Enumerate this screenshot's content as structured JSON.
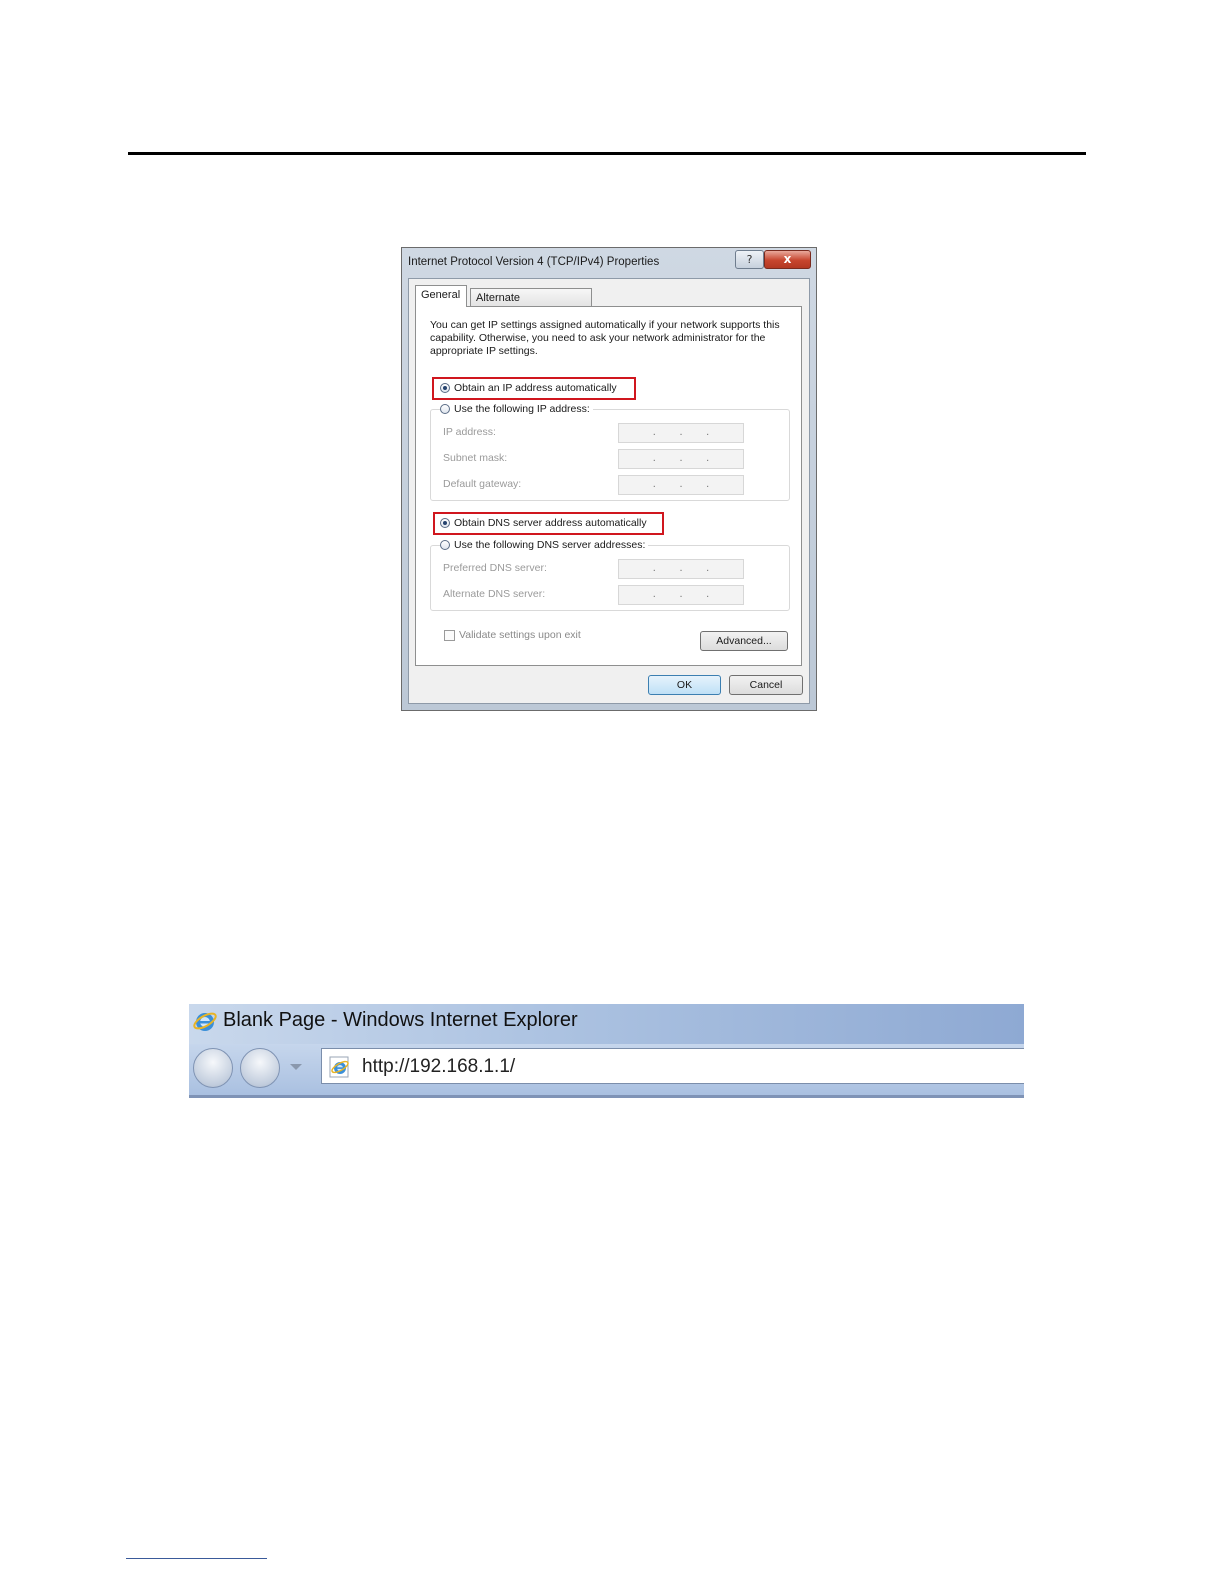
{
  "dialog": {
    "title": "Internet Protocol Version 4 (TCP/IPv4) Properties",
    "help_label": "?",
    "close_label": "x",
    "tabs": [
      {
        "label": "General"
      },
      {
        "label": "Alternate Configuration"
      }
    ],
    "description": "You can get IP settings assigned automatically if your network supports this capability. Otherwise, you need to ask your network administrator for the appropriate IP settings.",
    "ip_auto_label": "Obtain an IP address automatically",
    "ip_manual_label": "Use the following IP address:",
    "ip_fields": [
      {
        "label": "IP address:"
      },
      {
        "label": "Subnet mask:"
      },
      {
        "label": "Default gateway:"
      }
    ],
    "dns_auto_label": "Obtain DNS server address automatically",
    "dns_manual_label": "Use the following DNS server addresses:",
    "dns_fields": [
      {
        "label": "Preferred DNS server:"
      },
      {
        "label": "Alternate DNS server:"
      }
    ],
    "ip_dot": ".",
    "validate_label": "Validate settings upon exit",
    "advanced_label": "Advanced...",
    "ok_label": "OK",
    "cancel_label": "Cancel",
    "highlight_color": "#d0161e"
  },
  "browser": {
    "title": "Blank Page - Windows Internet Explorer",
    "address": "http://192.168.1.1/"
  }
}
